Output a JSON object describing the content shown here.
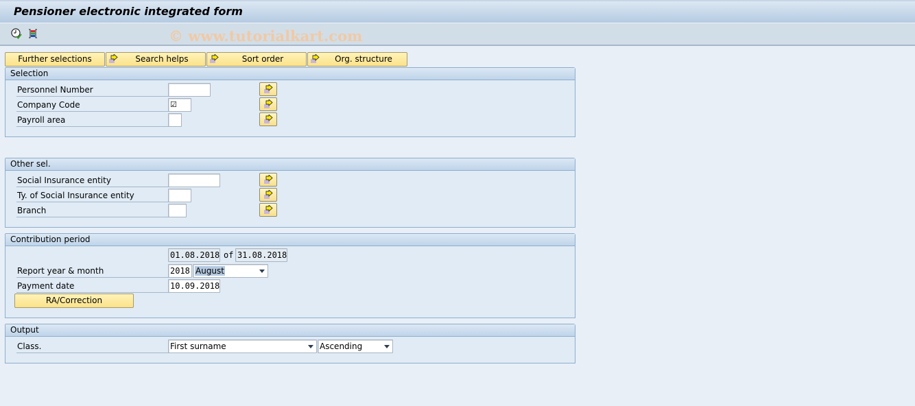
{
  "window": {
    "title": "Pensioner electronic integrated form"
  },
  "app_toolbar": {
    "icons": [
      {
        "name": "execute-icon",
        "tooltip": "Execute"
      },
      {
        "name": "get-variant-icon",
        "tooltip": "Get Variant"
      }
    ],
    "watermark": "© www.tutorialkart.com"
  },
  "selection_buttons": [
    {
      "label": "Further selections",
      "icon": ""
    },
    {
      "label": "Search helps",
      "icon": "multiple-selection-arrow-icon"
    },
    {
      "label": "Sort order",
      "icon": "multiple-selection-arrow-icon"
    },
    {
      "label": "Org. structure",
      "icon": "multiple-selection-arrow-icon"
    }
  ],
  "groups": {
    "selection": {
      "title": "Selection",
      "fields": [
        {
          "label": "Personnel Number",
          "value": ""
        },
        {
          "label": "Company Code",
          "value": "☑"
        },
        {
          "label": "Payroll area",
          "value": ""
        }
      ]
    },
    "other_sel": {
      "title": "Other sel.",
      "fields": [
        {
          "label": "Social Insurance entity",
          "value": ""
        },
        {
          "label": "Ty. of Social Insurance entity",
          "value": ""
        },
        {
          "label": "Branch",
          "value": ""
        }
      ]
    },
    "contribution_period": {
      "title": "Contribution period",
      "period_from": "01.08.2018",
      "period_of_label": "of",
      "period_to": "31.08.2018",
      "report_label": "Report year & month",
      "report_year": "2018",
      "report_month": "August",
      "payment_label": "Payment date",
      "payment_date": "10.09.2018",
      "correction_button": "RA/Correction"
    },
    "output": {
      "title": "Output",
      "class_label": "Class.",
      "class_value": "First surname",
      "order_value": "Ascending"
    }
  },
  "colors": {
    "background": "#e8eff7",
    "button_yellow": "#fbe28a",
    "group_border": "#8fadcb",
    "watermark": "#f1c9a4"
  }
}
